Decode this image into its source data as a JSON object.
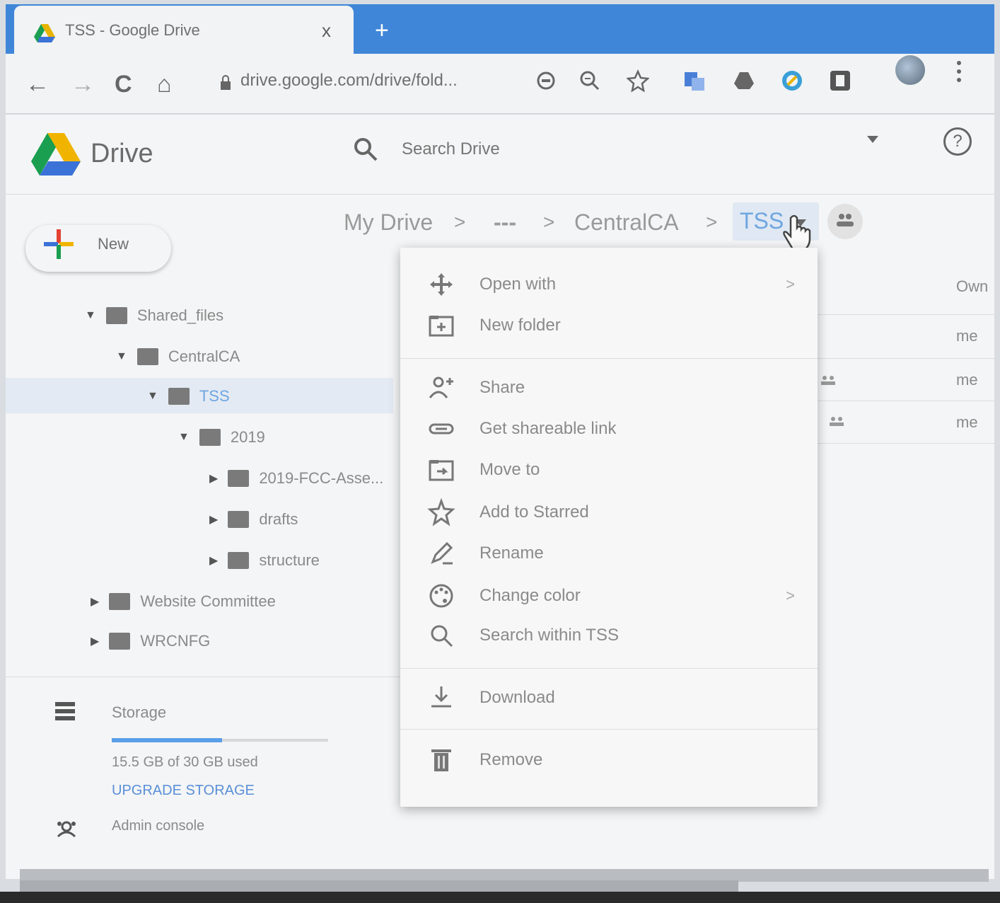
{
  "browser": {
    "tab_title": "TSS - Google Drive",
    "close_tab": "x",
    "new_tab": "+",
    "url": "drive.google.com/drive/fold...",
    "nav": {
      "back": "←",
      "forward": "→",
      "reload": "C",
      "home": "⌂"
    }
  },
  "header": {
    "app_title": "Drive",
    "search_placeholder": "Search Drive",
    "help": "?"
  },
  "new_button": {
    "label": "New"
  },
  "breadcrumb": {
    "items": [
      "My Drive",
      "---",
      "CentralCA"
    ],
    "current": "TSS",
    "separator": ">"
  },
  "tree": [
    {
      "label": "Shared_files",
      "expanded": true
    },
    {
      "label": "CentralCA",
      "expanded": true
    },
    {
      "label": "TSS",
      "expanded": true,
      "selected": true
    },
    {
      "label": "2019",
      "expanded": true
    },
    {
      "label": "2019-FCC-Asse...",
      "expanded": false
    },
    {
      "label": "drafts",
      "expanded": false
    },
    {
      "label": "structure",
      "expanded": false
    },
    {
      "label": "Website Committee",
      "expanded": false
    },
    {
      "label": "WRCNFG",
      "expanded": false
    }
  ],
  "storage": {
    "label": "Storage",
    "used_text": "15.5 GB of 30 GB used",
    "used_fraction": 0.517,
    "upgrade": "UPGRADE STORAGE"
  },
  "admin": {
    "label": "Admin console"
  },
  "file_list": {
    "owner_header": "Own",
    "owners": [
      "me",
      "me",
      "me"
    ]
  },
  "context_menu": {
    "items": [
      {
        "label": "Open with",
        "icon": "open-with-icon",
        "submenu": true
      },
      {
        "label": "New folder",
        "icon": "new-folder-icon"
      },
      {
        "label": "Share",
        "icon": "share-person-icon"
      },
      {
        "label": "Get shareable link",
        "icon": "link-icon"
      },
      {
        "label": "Move to",
        "icon": "move-to-icon"
      },
      {
        "label": "Add to Starred",
        "icon": "star-icon"
      },
      {
        "label": "Rename",
        "icon": "pencil-icon"
      },
      {
        "label": "Change color",
        "icon": "palette-icon",
        "submenu": true
      },
      {
        "label": "Search within TSS",
        "icon": "search-icon"
      },
      {
        "label": "Download",
        "icon": "download-icon"
      },
      {
        "label": "Remove",
        "icon": "trash-icon"
      }
    ],
    "submenu_arrow": ">"
  },
  "colors": {
    "tabstrip": "#3f86d8",
    "accent_blue": "#5a9ee8",
    "selected_bg": "#e3eaf3"
  }
}
